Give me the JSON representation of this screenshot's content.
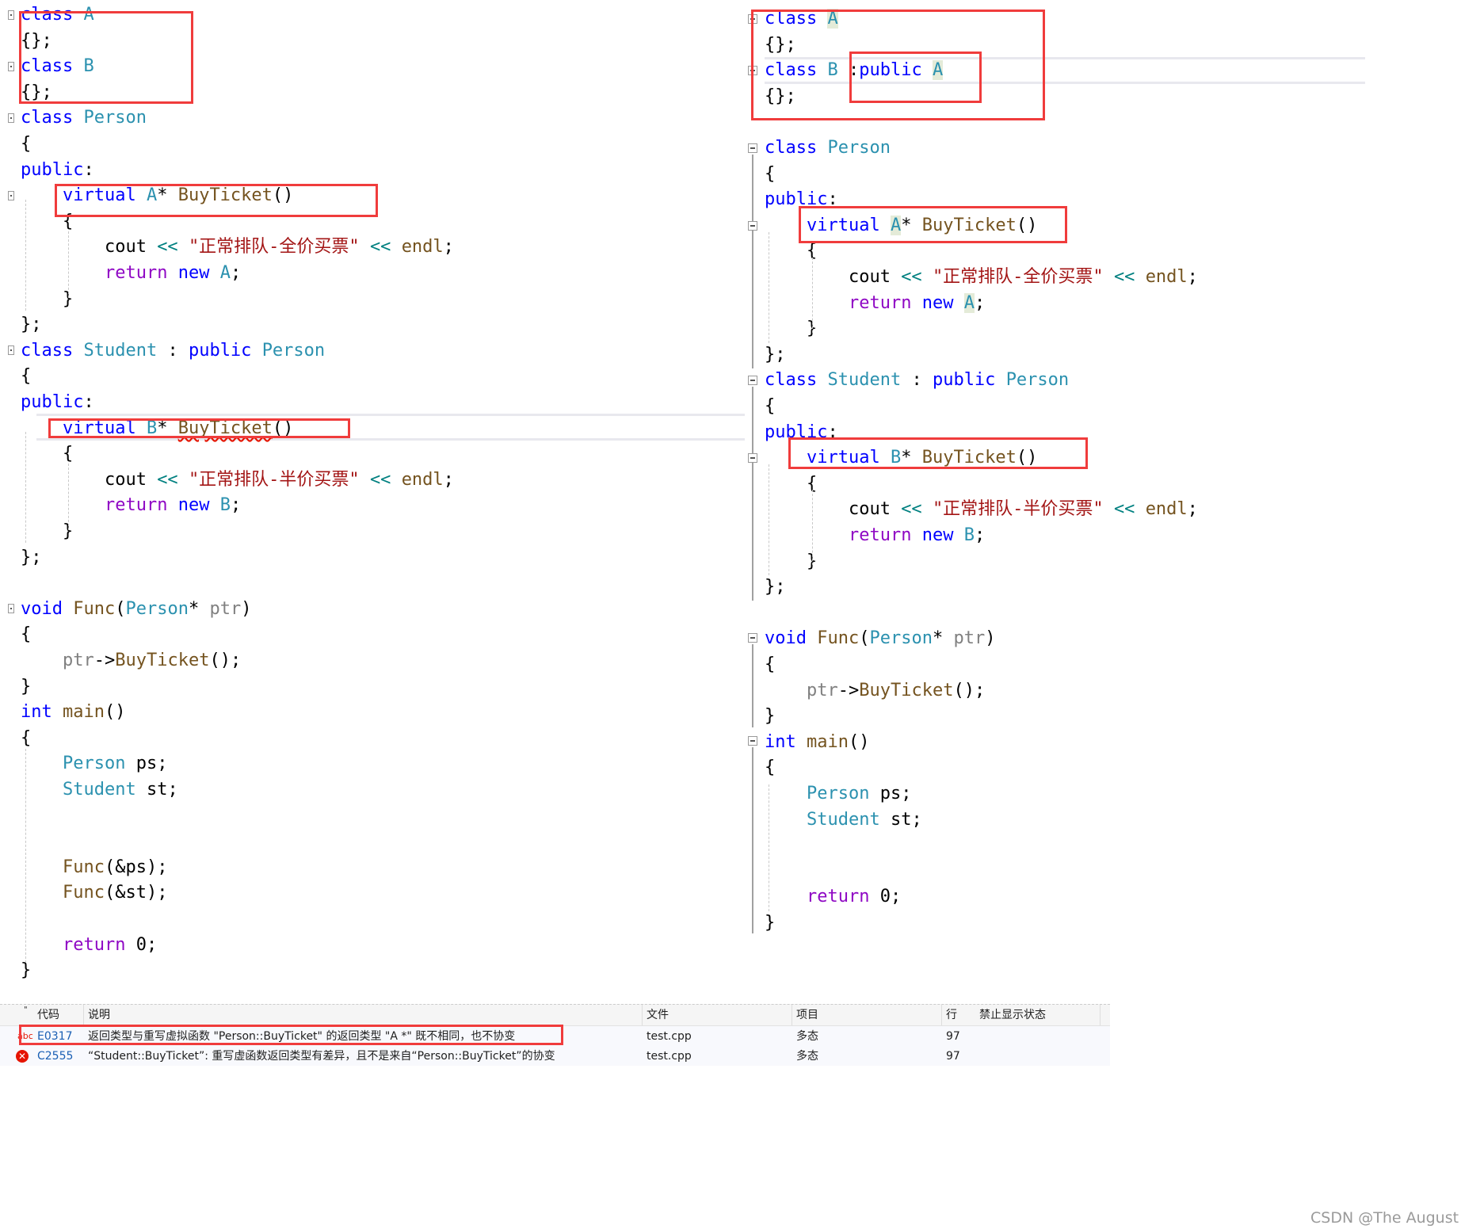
{
  "left": {
    "lines": [
      [
        [
          "class",
          "keyword"
        ],
        [
          " ",
          "plain"
        ],
        [
          "A",
          "type"
        ]
      ],
      [
        [
          "{};",
          "plain"
        ]
      ],
      [
        [
          "class",
          "keyword"
        ],
        [
          " ",
          "plain"
        ],
        [
          "B",
          "type"
        ]
      ],
      [
        [
          "{};",
          "plain"
        ]
      ],
      [
        [
          "class",
          "keyword"
        ],
        [
          " ",
          "plain"
        ],
        [
          "Person",
          "type"
        ]
      ],
      [
        [
          "{",
          "plain"
        ]
      ],
      [
        [
          "public",
          "keyword"
        ],
        [
          ":",
          "plain"
        ]
      ],
      [
        [
          "    ",
          "plain"
        ],
        [
          "virtual",
          "keyword"
        ],
        [
          " ",
          "plain"
        ],
        [
          "A",
          "type"
        ],
        [
          "* ",
          "plain"
        ],
        [
          "BuyTicket",
          "func"
        ],
        [
          "()",
          "plain"
        ]
      ],
      [
        [
          "    {",
          "plain"
        ]
      ],
      [
        [
          "        cout ",
          "plain"
        ],
        [
          "<<",
          "op"
        ],
        [
          " ",
          "plain"
        ],
        [
          "\"正常排队-全价买票\"",
          "string"
        ],
        [
          " ",
          "plain"
        ],
        [
          "<<",
          "op"
        ],
        [
          " ",
          "plain"
        ],
        [
          "endl",
          "func"
        ],
        [
          ";",
          "plain"
        ]
      ],
      [
        [
          "        ",
          "plain"
        ],
        [
          "return",
          "return"
        ],
        [
          " ",
          "plain"
        ],
        [
          "new",
          "keyword"
        ],
        [
          " ",
          "plain"
        ],
        [
          "A",
          "type"
        ],
        [
          ";",
          "plain"
        ]
      ],
      [
        [
          "    }",
          "plain"
        ]
      ],
      [
        [
          "};",
          "plain"
        ]
      ],
      [
        [
          "class",
          "keyword"
        ],
        [
          " ",
          "plain"
        ],
        [
          "Student",
          "type"
        ],
        [
          " : ",
          "plain"
        ],
        [
          "public",
          "keyword"
        ],
        [
          " ",
          "plain"
        ],
        [
          "Person",
          "type"
        ]
      ],
      [
        [
          "{",
          "plain"
        ]
      ],
      [
        [
          "public",
          "keyword"
        ],
        [
          ":",
          "plain"
        ]
      ],
      [
        [
          "    ",
          "plain"
        ],
        [
          "virtual",
          "keyword"
        ],
        [
          " ",
          "plain"
        ],
        [
          "B",
          "type"
        ],
        [
          "* ",
          "plain"
        ],
        [
          "BuyTicket",
          "func-squiggle"
        ],
        [
          "()",
          "plain"
        ]
      ],
      [
        [
          "    {",
          "plain"
        ]
      ],
      [
        [
          "        cout ",
          "plain"
        ],
        [
          "<<",
          "op"
        ],
        [
          " ",
          "plain"
        ],
        [
          "\"正常排队-半价买票\"",
          "string"
        ],
        [
          " ",
          "plain"
        ],
        [
          "<<",
          "op"
        ],
        [
          " ",
          "plain"
        ],
        [
          "endl",
          "func"
        ],
        [
          ";",
          "plain"
        ]
      ],
      [
        [
          "        ",
          "plain"
        ],
        [
          "return",
          "return"
        ],
        [
          " ",
          "plain"
        ],
        [
          "new",
          "keyword"
        ],
        [
          " ",
          "plain"
        ],
        [
          "B",
          "type"
        ],
        [
          ";",
          "plain"
        ]
      ],
      [
        [
          "    }",
          "plain"
        ]
      ],
      [
        [
          "};",
          "plain"
        ]
      ],
      [],
      [
        [
          "void",
          "keyword"
        ],
        [
          " ",
          "plain"
        ],
        [
          "Func",
          "func"
        ],
        [
          "(",
          "plain"
        ],
        [
          "Person",
          "type"
        ],
        [
          "* ",
          "plain"
        ],
        [
          "ptr",
          "param"
        ],
        [
          ")",
          "plain"
        ]
      ],
      [
        [
          "{",
          "plain"
        ]
      ],
      [
        [
          "    ",
          "plain"
        ],
        [
          "ptr",
          "param"
        ],
        [
          "->",
          "plain"
        ],
        [
          "BuyTicket",
          "func"
        ],
        [
          "();",
          "plain"
        ]
      ],
      [
        [
          "}",
          "plain"
        ]
      ],
      [
        [
          "int",
          "keyword"
        ],
        [
          " ",
          "plain"
        ],
        [
          "main",
          "func"
        ],
        [
          "()",
          "plain"
        ]
      ],
      [
        [
          "{",
          "plain"
        ]
      ],
      [
        [
          "    ",
          "plain"
        ],
        [
          "Person",
          "type"
        ],
        [
          " ps;",
          "plain"
        ]
      ],
      [
        [
          "    ",
          "plain"
        ],
        [
          "Student",
          "type"
        ],
        [
          " st;",
          "plain"
        ]
      ],
      [],
      [],
      [
        [
          "    ",
          "plain"
        ],
        [
          "Func",
          "func"
        ],
        [
          "(&ps);",
          "plain"
        ]
      ],
      [
        [
          "    ",
          "plain"
        ],
        [
          "Func",
          "func"
        ],
        [
          "(&st);",
          "plain"
        ]
      ],
      [],
      [
        [
          "    ",
          "plain"
        ],
        [
          "return",
          "return"
        ],
        [
          " 0;",
          "plain"
        ]
      ],
      [
        [
          "}",
          "plain"
        ]
      ]
    ]
  },
  "right": {
    "lines": [
      [
        [
          "class",
          "keyword"
        ],
        [
          " ",
          "plain"
        ],
        [
          "A",
          "type-hl"
        ]
      ],
      [
        [
          "{};",
          "plain"
        ]
      ],
      [
        [
          "class",
          "keyword"
        ],
        [
          " ",
          "plain"
        ],
        [
          "B",
          "type"
        ],
        [
          " :",
          "plain"
        ],
        [
          "public",
          "keyword"
        ],
        [
          " ",
          "plain"
        ],
        [
          "A",
          "type-hl"
        ]
      ],
      [
        [
          "{};",
          "plain"
        ]
      ],
      [],
      [
        [
          "class",
          "keyword"
        ],
        [
          " ",
          "plain"
        ],
        [
          "Person",
          "type"
        ]
      ],
      [
        [
          "{",
          "plain"
        ]
      ],
      [
        [
          "public",
          "keyword"
        ],
        [
          ":",
          "plain"
        ]
      ],
      [
        [
          "    ",
          "plain"
        ],
        [
          "virtual",
          "keyword"
        ],
        [
          " ",
          "plain"
        ],
        [
          "A",
          "type-hl"
        ],
        [
          "* ",
          "plain"
        ],
        [
          "BuyTicket",
          "func"
        ],
        [
          "()",
          "plain"
        ]
      ],
      [
        [
          "    {",
          "plain"
        ]
      ],
      [
        [
          "        cout ",
          "plain"
        ],
        [
          "<<",
          "op"
        ],
        [
          " ",
          "plain"
        ],
        [
          "\"正常排队-全价买票\"",
          "string"
        ],
        [
          " ",
          "plain"
        ],
        [
          "<<",
          "op"
        ],
        [
          " ",
          "plain"
        ],
        [
          "endl",
          "func"
        ],
        [
          ";",
          "plain"
        ]
      ],
      [
        [
          "        ",
          "plain"
        ],
        [
          "return",
          "return"
        ],
        [
          " ",
          "plain"
        ],
        [
          "new",
          "keyword"
        ],
        [
          " ",
          "plain"
        ],
        [
          "A",
          "type-hl"
        ],
        [
          ";",
          "plain"
        ]
      ],
      [
        [
          "    }",
          "plain"
        ]
      ],
      [
        [
          "};",
          "plain"
        ]
      ],
      [
        [
          "class",
          "keyword"
        ],
        [
          " ",
          "plain"
        ],
        [
          "Student",
          "type"
        ],
        [
          " : ",
          "plain"
        ],
        [
          "public",
          "keyword"
        ],
        [
          " ",
          "plain"
        ],
        [
          "Person",
          "type"
        ]
      ],
      [
        [
          "{",
          "plain"
        ]
      ],
      [
        [
          "public",
          "keyword"
        ],
        [
          ":",
          "plain"
        ]
      ],
      [
        [
          "    ",
          "plain"
        ],
        [
          "virtual",
          "keyword"
        ],
        [
          " ",
          "plain"
        ],
        [
          "B",
          "type"
        ],
        [
          "* ",
          "plain"
        ],
        [
          "BuyTicket",
          "func"
        ],
        [
          "()",
          "plain"
        ]
      ],
      [
        [
          "    {",
          "plain"
        ]
      ],
      [
        [
          "        cout ",
          "plain"
        ],
        [
          "<<",
          "op"
        ],
        [
          " ",
          "plain"
        ],
        [
          "\"正常排队-半价买票\"",
          "string"
        ],
        [
          " ",
          "plain"
        ],
        [
          "<<",
          "op"
        ],
        [
          " ",
          "plain"
        ],
        [
          "endl",
          "func"
        ],
        [
          ";",
          "plain"
        ]
      ],
      [
        [
          "        ",
          "plain"
        ],
        [
          "return",
          "return"
        ],
        [
          " ",
          "plain"
        ],
        [
          "new",
          "keyword"
        ],
        [
          " ",
          "plain"
        ],
        [
          "B",
          "type"
        ],
        [
          ";",
          "plain"
        ]
      ],
      [
        [
          "    }",
          "plain"
        ]
      ],
      [
        [
          "};",
          "plain"
        ]
      ],
      [],
      [
        [
          "void",
          "keyword"
        ],
        [
          " ",
          "plain"
        ],
        [
          "Func",
          "func"
        ],
        [
          "(",
          "plain"
        ],
        [
          "Person",
          "type"
        ],
        [
          "* ",
          "plain"
        ],
        [
          "ptr",
          "param"
        ],
        [
          ")",
          "plain"
        ]
      ],
      [
        [
          "{",
          "plain"
        ]
      ],
      [
        [
          "    ",
          "plain"
        ],
        [
          "ptr",
          "param"
        ],
        [
          "->",
          "plain"
        ],
        [
          "BuyTicket",
          "func"
        ],
        [
          "();",
          "plain"
        ]
      ],
      [
        [
          "}",
          "plain"
        ]
      ],
      [
        [
          "int",
          "keyword"
        ],
        [
          " ",
          "plain"
        ],
        [
          "main",
          "func"
        ],
        [
          "()",
          "plain"
        ]
      ],
      [
        [
          "{",
          "plain"
        ]
      ],
      [
        [
          "    ",
          "plain"
        ],
        [
          "Person",
          "type"
        ],
        [
          " ps;",
          "plain"
        ]
      ],
      [
        [
          "    ",
          "plain"
        ],
        [
          "Student",
          "type"
        ],
        [
          " st;",
          "plain"
        ]
      ],
      [],
      [],
      [
        [
          "    ",
          "plain"
        ],
        [
          "return",
          "return"
        ],
        [
          " 0;",
          "plain"
        ]
      ],
      [
        [
          "}",
          "plain"
        ]
      ]
    ]
  },
  "error_list": {
    "columns": [
      "代码",
      "说明",
      "文件",
      "项目",
      "行",
      "禁止显示状态"
    ],
    "rows": [
      {
        "icon": "squiggle-warning-icon",
        "code": "E0317",
        "description": "返回类型与重写虚拟函数 \"Person::BuyTicket\" 的返回类型 \"A *\" 既不相同，也不协变",
        "file": "test.cpp",
        "project": "多态",
        "line": "97",
        "suppression": ""
      },
      {
        "icon": "error-circle-icon",
        "code": "C2555",
        "description": "“Student::BuyTicket”: 重写虚函数返回类型有差异，且不是来自“Person::BuyTicket”的协变",
        "file": "test.cpp",
        "project": "多态",
        "line": "97",
        "suppression": ""
      }
    ]
  },
  "watermark": "CSDN @The   August",
  "colors": {
    "annotation_box": "#f03c3c",
    "keyword": "#0000ff",
    "type": "#2b91af",
    "string": "#a31515",
    "error": "#e51400"
  }
}
